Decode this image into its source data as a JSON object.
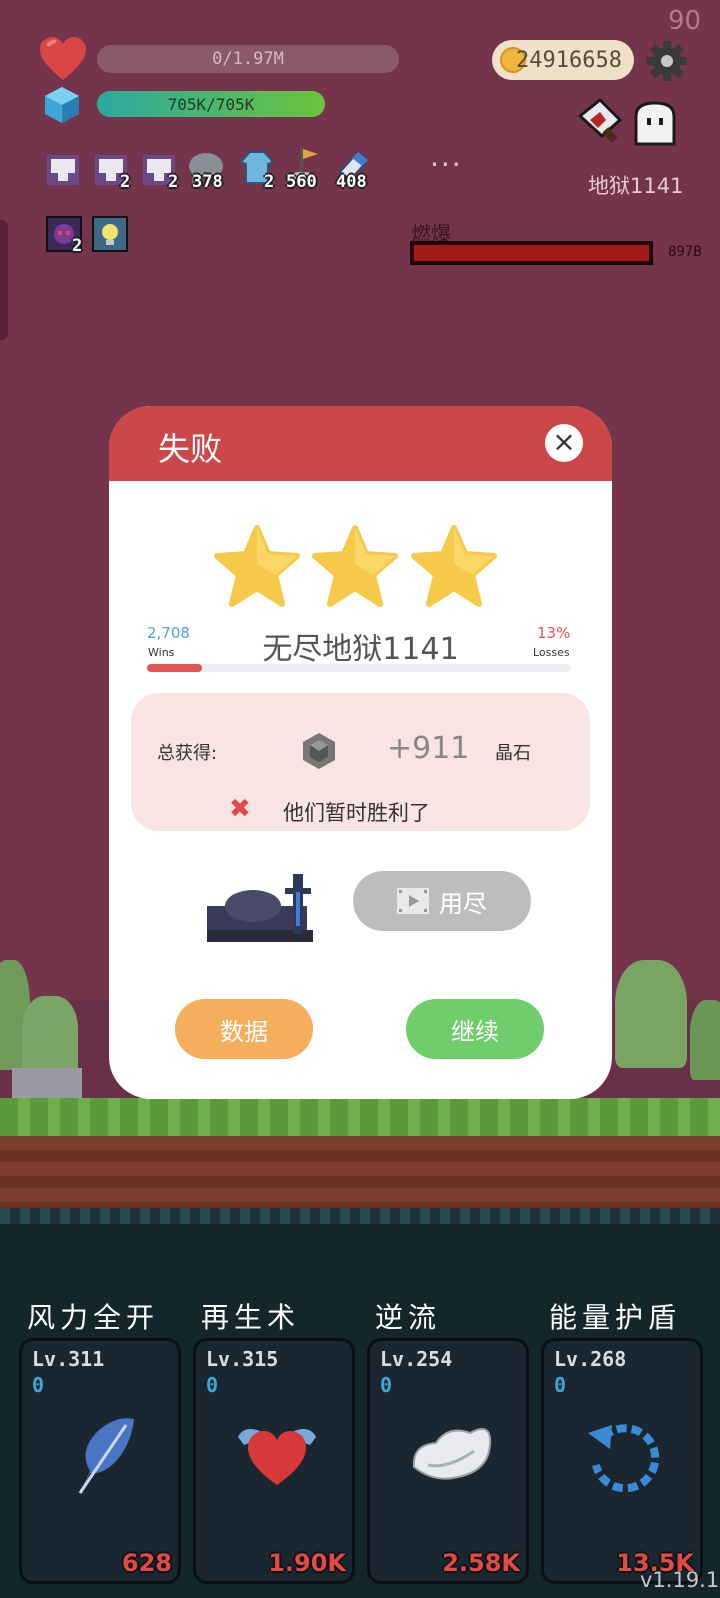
{
  "hud": {
    "fps": "90",
    "hp_text": "0/1.97M",
    "hp_fraction": 0,
    "shield_text": "705K/705K",
    "shield_fraction": 1,
    "coins": "24916658",
    "more_label": "···",
    "stage_label": "地狱1141",
    "inventory": [
      {
        "icon": "cloth-bundle-icon",
        "count": ""
      },
      {
        "icon": "cloth-bundle-icon",
        "count": "2"
      },
      {
        "icon": "cloth-bundle-icon",
        "count": "2"
      },
      {
        "icon": "elephant-icon",
        "count": "378"
      },
      {
        "icon": "coat-icon",
        "count": "2"
      },
      {
        "icon": "flag-icon",
        "count": "560"
      },
      {
        "icon": "eraser-icon",
        "count": "408"
      }
    ],
    "buff_count": "2"
  },
  "enemy": {
    "name": "燃爆",
    "hp_text": "897B",
    "hp_fraction": 1
  },
  "dialog": {
    "title": "失败",
    "close_label": "×",
    "stars": 3,
    "wins_value": "2,708",
    "wins_label": "Wins",
    "losses_value": "13%",
    "losses_label": "Losses",
    "stage_name": "无尽地狱1141",
    "progress_fraction": 0.13,
    "reward_label": "总获得:",
    "reward_amount": "+911",
    "reward_unit": "晶石",
    "result_text": "他们暂时胜利了",
    "video_button": "用尽",
    "data_button": "数据",
    "continue_button": "继续"
  },
  "skills": [
    {
      "title": "风力全开",
      "level": "Lv.311",
      "charges": "0",
      "cost": "628",
      "icon": "feather-icon"
    },
    {
      "title": "再生术",
      "level": "Lv.315",
      "charges": "0",
      "cost": "1.90K",
      "icon": "winged-heart-icon"
    },
    {
      "title": "逆流",
      "level": "Lv.254",
      "charges": "0",
      "cost": "2.58K",
      "icon": "wing-icon"
    },
    {
      "title": "能量护盾",
      "level": "Lv.268",
      "charges": "0",
      "cost": "13.5K",
      "icon": "refresh-icon"
    }
  ],
  "version": "v1.19.1",
  "colors": {
    "background": "#74344c",
    "dialog_header": "#cc4747",
    "star": "#f7c948",
    "data_button": "#f4ae5c",
    "continue_button": "#70cd6c",
    "cost": "#e24a46"
  }
}
